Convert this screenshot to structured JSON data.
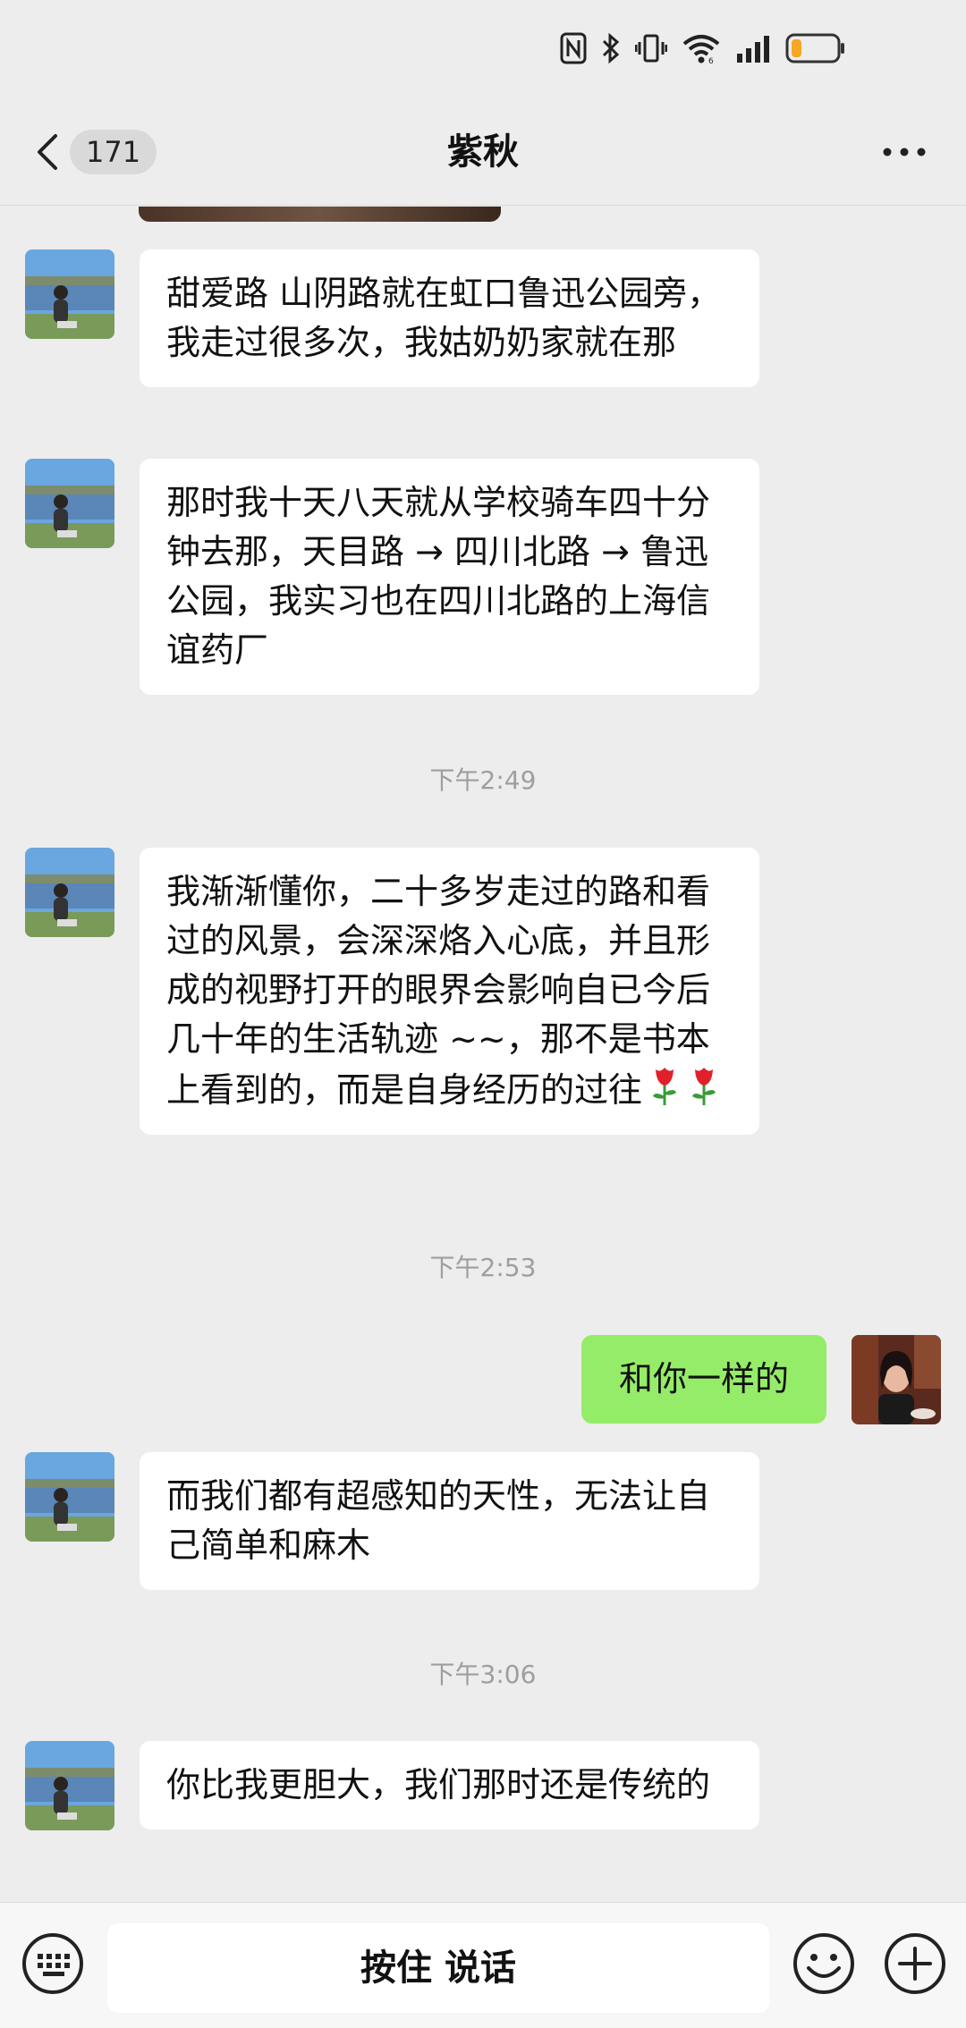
{
  "status": {
    "icons": [
      "nfc-icon",
      "bluetooth-icon",
      "vibrate-icon",
      "wifi-icon",
      "signal-icon",
      "battery-icon"
    ],
    "battery_color": "#f5a623"
  },
  "header": {
    "unread_count": "171",
    "title": "紫秋"
  },
  "messages": [
    {
      "type": "in",
      "text": "甜爱路  山阴路就在虹口鲁迅公园旁，我走过很多次，我姑奶奶家就在那"
    },
    {
      "type": "in",
      "text": "那时我十天八天就从学校骑车四十分钟去那，天目路 → 四川北路 → 鲁迅公园，我实习也在四川北路的上海信谊药厂"
    },
    {
      "type": "time",
      "text": "下午2:49"
    },
    {
      "type": "in",
      "text": "我渐渐懂你，二十多岁走过的路和看过的风景，会深深烙入心底，并且形成的视野打开的眼界会影响自已今后几十年的生活轨迹 ~~，那不是书本上看到的，而是自身经历的过往",
      "emoji": [
        "rose-emoji",
        "rose-emoji"
      ]
    },
    {
      "type": "time",
      "text": "下午2:53"
    },
    {
      "type": "out",
      "text": "和你一样的"
    },
    {
      "type": "in",
      "text": "而我们都有超感知的天性，无法让自己简单和麻木"
    },
    {
      "type": "time",
      "text": "下午3:06"
    },
    {
      "type": "in",
      "text": "你比我更胆大，我们那时还是传统的"
    }
  ],
  "input": {
    "voice_label": "按住 说话"
  },
  "colors": {
    "background": "#ededed",
    "incoming_bubble": "#ffffff",
    "outgoing_bubble": "#95ec69",
    "timestamp": "#9e9e9e"
  }
}
